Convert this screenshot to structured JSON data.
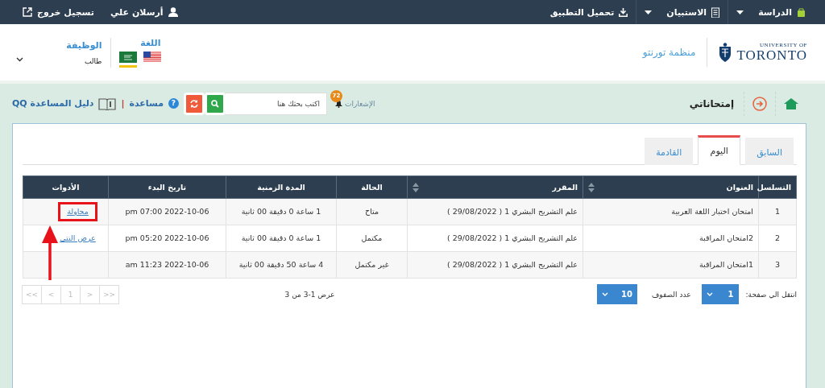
{
  "topbar": {
    "menus": [
      {
        "label": "الدراسة",
        "kind": "study"
      },
      {
        "label": "الاستبيان",
        "kind": "survey"
      },
      {
        "label": "تحميل التطبيق",
        "kind": "download"
      }
    ],
    "user": "أرسلان علي",
    "logout": "تسجيل خروج"
  },
  "header": {
    "logo_top": "UNIVERSITY OF",
    "logo_bottom": "TORONTO",
    "org": "منظمة تورنتو",
    "language_label": "اللغة",
    "languages": [
      {
        "kind": "saudi",
        "selected": true
      },
      {
        "kind": "us",
        "selected": false
      }
    ],
    "role_label": "الوظيفة",
    "role": "طالب"
  },
  "page": {
    "title": "إمتحاناتي",
    "notifications": "الإشعارات",
    "badge": "72",
    "search": {
      "placeholder": "اكتب بحثك هنا"
    },
    "help_icon": "?",
    "help": "مساعدة",
    "separator": "|",
    "guide": "دليل المساعدة QQ"
  },
  "tabs": [
    {
      "label": "السابق",
      "selected": false
    },
    {
      "label": "اليوم",
      "selected": true
    },
    {
      "label": "القادمة",
      "selected": false
    }
  ],
  "table": {
    "columns": [
      {
        "label": "التسلسل",
        "sortable": false
      },
      {
        "label": "العنوان",
        "sortable": true
      },
      {
        "label": "المقرر",
        "sortable": true
      },
      {
        "label": "الحالة",
        "sortable": false
      },
      {
        "label": "المدة الزمنية",
        "sortable": false
      },
      {
        "label": "تاريخ البدء",
        "sortable": false
      },
      {
        "label": "الأدوات",
        "sortable": false
      }
    ],
    "rows": [
      {
        "cells": [
          "1",
          "امتحان اختبار اللغة العربية",
          "علم التشريح البشري 1 ( 29/08/2022 )",
          "متاح",
          "1 ساعة 0 دقيقة 00 ثانية",
          "pm 07:00 2022-10-06"
        ],
        "action": {
          "label": "محاولة",
          "highlighted": true
        }
      },
      {
        "cells": [
          "2",
          "2امتحان المراقبة",
          "علم التشريح البشري 1 ( 29/08/2022 )",
          "مكتمل",
          "1 ساعة 0 دقيقة 00 ثانية",
          "pm 05:20 2022-10-06"
        ],
        "action": {
          "label": "عرض النتي",
          "highlighted": false
        }
      },
      {
        "cells": [
          "3",
          "1امتحان المراقبة",
          "علم التشريح البشري 1 ( 29/08/2022 )",
          "غير مكتمل",
          "4 ساعة 50 دقيقة 00 ثانية",
          "am 11:23 2022-10-06"
        ]
      }
    ]
  },
  "pagination": {
    "goto_label": "انتقل الي صفحة:",
    "page": "1",
    "rows_label": "عدد الصفوف",
    "rows": "10",
    "summary": "عرض 1-3 من 3",
    "pager": [
      ">>",
      ">",
      "1",
      "<",
      "<<"
    ]
  },
  "annotations": [
    {
      "kind": "arrow"
    }
  ]
}
